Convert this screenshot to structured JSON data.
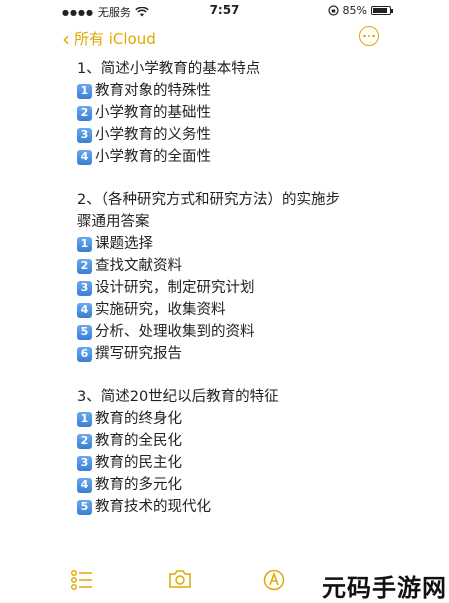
{
  "status_bar": {
    "carrier": "无服务",
    "time": "7:57",
    "battery": "85%",
    "battery_level": 0.85
  },
  "nav": {
    "back_label": "所有 iCloud"
  },
  "note": {
    "sections": [
      {
        "title": "1、简述小学教育的基本特点",
        "items": [
          {
            "num": "1",
            "text": "教育对象的特殊性"
          },
          {
            "num": "2",
            "text": "小学教育的基础性"
          },
          {
            "num": "3",
            "text": "小学教育的义务性"
          },
          {
            "num": "4",
            "text": "小学教育的全面性"
          }
        ]
      },
      {
        "title_line1": "2、（各种研究方式和研究方法）的实施步",
        "title_line2": "骤通用答案",
        "items": [
          {
            "num": "1",
            "text": "课题选择"
          },
          {
            "num": "2",
            "text": "查找文献资料"
          },
          {
            "num": "3",
            "text": "设计研究，制定研究计划"
          },
          {
            "num": "4",
            "text": "实施研究，收集资料"
          },
          {
            "num": "5",
            "text": "分析、处理收集到的资料"
          },
          {
            "num": "6",
            "text": "撰写研究报告"
          }
        ]
      },
      {
        "title": "3、简述20世纪以后教育的特征",
        "items": [
          {
            "num": "1",
            "text": "教育的终身化"
          },
          {
            "num": "2",
            "text": "教育的全民化"
          },
          {
            "num": "3",
            "text": "教育的民主化"
          },
          {
            "num": "4",
            "text": "教育的多元化"
          },
          {
            "num": "5",
            "text": "教育技术的现代化"
          }
        ]
      }
    ]
  },
  "toolbar": {
    "icons": [
      "checklist-icon",
      "camera-icon",
      "markup-icon"
    ]
  },
  "watermark": "元码手游网",
  "colors": {
    "accent": "#e0a800",
    "number_badge": "#4a90e2"
  }
}
